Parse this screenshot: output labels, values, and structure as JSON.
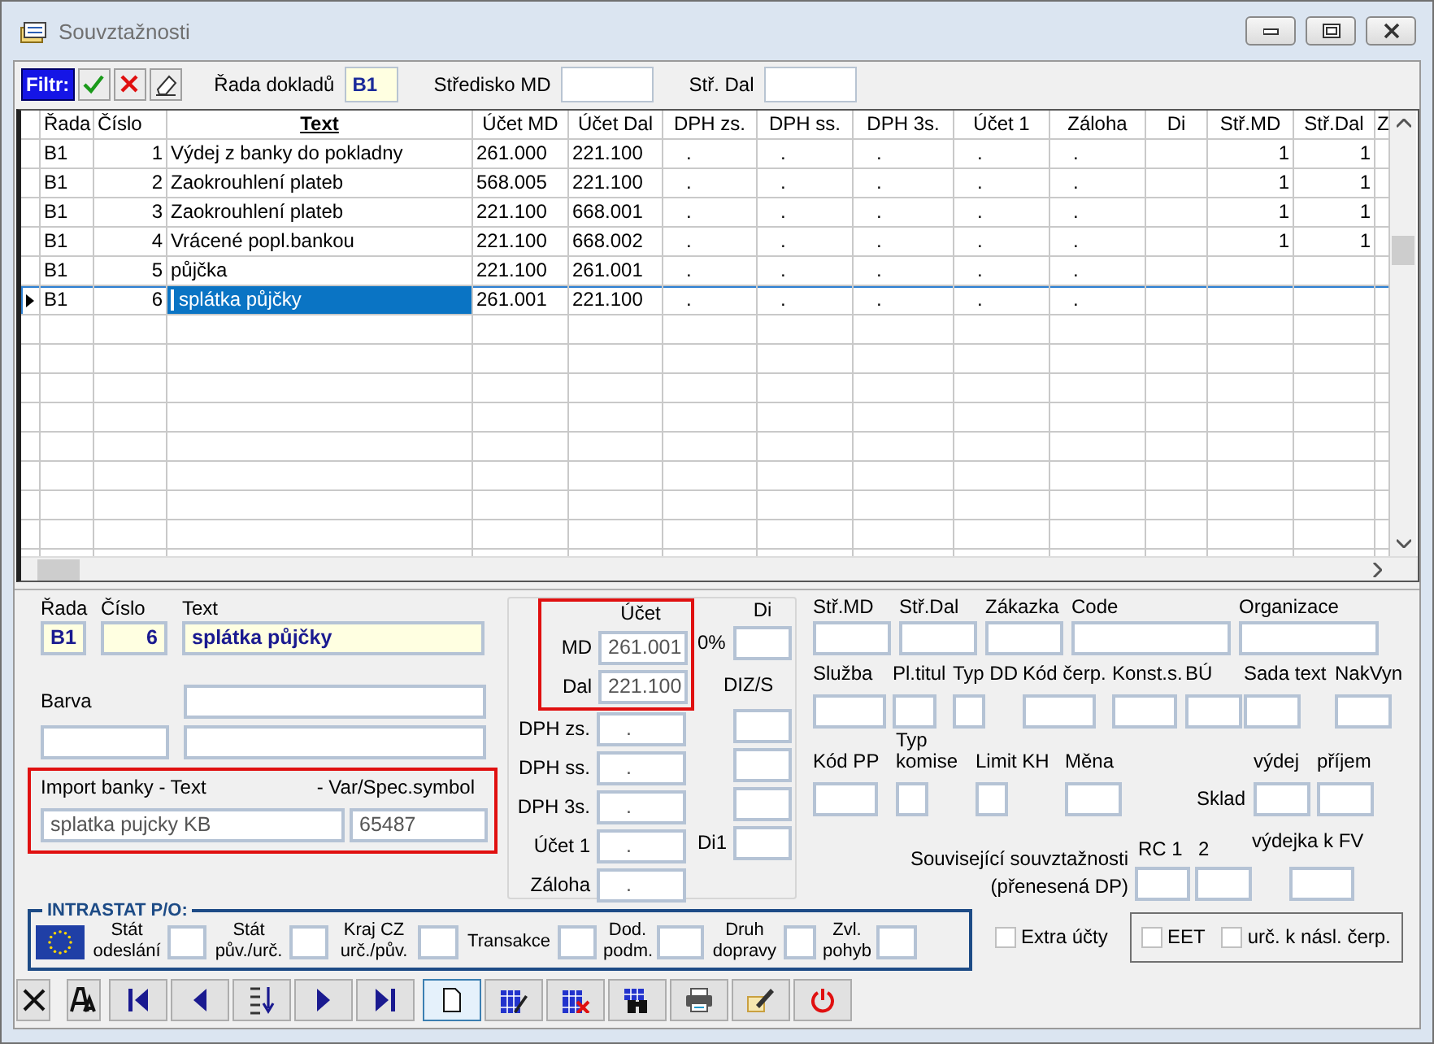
{
  "window": {
    "title": "Souvztažnosti"
  },
  "filter": {
    "label": "Filtr:",
    "fields": [
      {
        "label": "Řada dokladů",
        "value": "B1"
      },
      {
        "label": "Středisko MD"
      },
      {
        "label": "Stř. Dal"
      }
    ]
  },
  "table": {
    "columns": [
      {
        "label": "Řada",
        "sorted": false
      },
      {
        "label": "Číslo",
        "sorted": false
      },
      {
        "label": "Text",
        "sorted": true
      },
      {
        "label": "Účet MD",
        "sorted": false
      },
      {
        "label": "Účet Dal",
        "sorted": false
      },
      {
        "label": "DPH zs.",
        "sorted": false
      },
      {
        "label": "DPH ss.",
        "sorted": false
      },
      {
        "label": "DPH 3s.",
        "sorted": false
      },
      {
        "label": "Účet 1",
        "sorted": false
      },
      {
        "label": "Záloha",
        "sorted": false
      },
      {
        "label": "Di",
        "sorted": false
      },
      {
        "label": "Stř.MD",
        "sorted": false
      },
      {
        "label": "Stř.Dal",
        "sorted": false
      },
      {
        "label": "Z",
        "sorted": false
      }
    ],
    "rows": [
      {
        "selected": false,
        "cells": [
          "B1",
          "1",
          "Výdej z banky do pokladny",
          "261.000",
          "221.100",
          ".",
          ".",
          ".",
          ".",
          ".",
          null,
          "1",
          "1",
          null
        ]
      },
      {
        "selected": false,
        "cells": [
          "B1",
          "2",
          "Zaokrouhlení plateb",
          "568.005",
          "221.100",
          ".",
          ".",
          ".",
          ".",
          ".",
          null,
          "1",
          "1",
          null
        ]
      },
      {
        "selected": false,
        "cells": [
          "B1",
          "3",
          "Zaokrouhlení plateb",
          "221.100",
          "668.001",
          ".",
          ".",
          ".",
          ".",
          ".",
          null,
          "1",
          "1",
          null
        ]
      },
      {
        "selected": false,
        "cells": [
          "B1",
          "4",
          "Vrácené popl.bankou",
          "221.100",
          "668.002",
          ".",
          ".",
          ".",
          ".",
          ".",
          null,
          "1",
          "1",
          null
        ]
      },
      {
        "selected": false,
        "cells": [
          "B1",
          "5",
          "půjčka",
          "221.100",
          "261.001",
          ".",
          ".",
          ".",
          ".",
          ".",
          null,
          null,
          null,
          null
        ]
      },
      {
        "selected": true,
        "cells": [
          "B1",
          "6",
          "splátka půjčky",
          "261.001",
          "221.100",
          ".",
          ".",
          ".",
          ".",
          ".",
          null,
          null,
          null,
          null
        ]
      }
    ]
  },
  "record": [
    {
      "label": "Řada",
      "value": "B1"
    },
    {
      "label": "Číslo",
      "value": "6"
    },
    {
      "label": "Text",
      "value": "splátka půjčky"
    }
  ],
  "barva": {
    "label": "Barva"
  },
  "import_banky": {
    "text_label": "Import banky - Text",
    "symbol_label": "- Var/Spec.symbol",
    "text_value": "splatka pujcky KB",
    "symbol_value": "65487"
  },
  "ucet": {
    "title": "Účet",
    "md_label": "MD",
    "md_value": "261.001",
    "dal_label": "Dal",
    "dal_value": "221.100",
    "di_label": "Di",
    "percent": "0%",
    "diz_label": "DIZ/S",
    "di1_label": "Di1"
  },
  "vat_fields": [
    {
      "label": "DPH zs.",
      "value": "."
    },
    {
      "label": "DPH ss.",
      "value": "."
    },
    {
      "label": "DPH 3s.",
      "value": "."
    },
    {
      "label": "Účet 1",
      "value": "."
    },
    {
      "label": "Záloha",
      "value": "."
    }
  ],
  "right_rows": [
    [
      {
        "kind": "field",
        "label": "Stř.MD"
      },
      {
        "kind": "field",
        "label": "Stř.Dal"
      },
      {
        "kind": "field",
        "label": "Zákazka"
      },
      {
        "kind": "field",
        "label": "Code"
      },
      {
        "kind": "field",
        "label": "Organizace"
      }
    ],
    [
      {
        "kind": "field",
        "label": "Služba"
      },
      {
        "kind": "field",
        "label": "Pl.titul"
      },
      {
        "kind": "field",
        "label": "Typ DD"
      },
      {
        "kind": "field",
        "label": "Kód čerp."
      },
      {
        "kind": "field",
        "label": "Konst.s."
      },
      {
        "kind": "field",
        "label": "BÚ"
      },
      {
        "kind": "field",
        "label": "Sada text"
      },
      {
        "kind": "field",
        "label": "NakVyn"
      }
    ],
    [
      {
        "kind": "field",
        "label": "Kód PP"
      },
      {
        "kind": "field",
        "label": "Typ komise"
      },
      {
        "kind": "field",
        "label": "Limit KH"
      },
      {
        "kind": "field",
        "label": "Měna"
      },
      {
        "kind": "side",
        "label": "Sklad"
      },
      {
        "kind": "field",
        "label": "výdej"
      },
      {
        "kind": "field",
        "label": "příjem"
      }
    ]
  ],
  "related": {
    "label": "Související souvztažnosti (přenesená DP)",
    "fields": [
      {
        "label": "RC 1"
      },
      {
        "label": "2"
      },
      {
        "label": "výdejka k FV"
      }
    ]
  },
  "intrastat": {
    "title": "INTRASTAT P/O:",
    "fields": [
      {
        "label": "Stát odeslání"
      },
      {
        "label": "Stát pův./urč."
      },
      {
        "label": "Kraj CZ urč./pův."
      },
      {
        "label": "Transakce"
      },
      {
        "label": "Dod. podm."
      },
      {
        "label": "Druh dopravy"
      },
      {
        "label": "Zvl. pohyb"
      }
    ]
  },
  "extra": {
    "label": "Extra účty",
    "checked": false
  },
  "options": [
    {
      "label": "EET",
      "checked": false
    },
    {
      "label": "urč. k násl. čerp.",
      "checked": false
    }
  ],
  "toolbar": [
    {
      "kind": "delete",
      "selected": false
    },
    {
      "kind": "font",
      "selected": false
    },
    {
      "kind": "first",
      "selected": false
    },
    {
      "kind": "prev",
      "selected": false
    },
    {
      "kind": "sort",
      "selected": false
    },
    {
      "kind": "next",
      "selected": false
    },
    {
      "kind": "last",
      "selected": false
    },
    {
      "kind": "new",
      "selected": true
    },
    {
      "kind": "edit",
      "selected": false
    },
    {
      "kind": "remove",
      "selected": false
    },
    {
      "kind": "find",
      "selected": false
    },
    {
      "kind": "print",
      "selected": false
    },
    {
      "kind": "tools",
      "selected": false
    },
    {
      "kind": "exit",
      "selected": false
    }
  ]
}
